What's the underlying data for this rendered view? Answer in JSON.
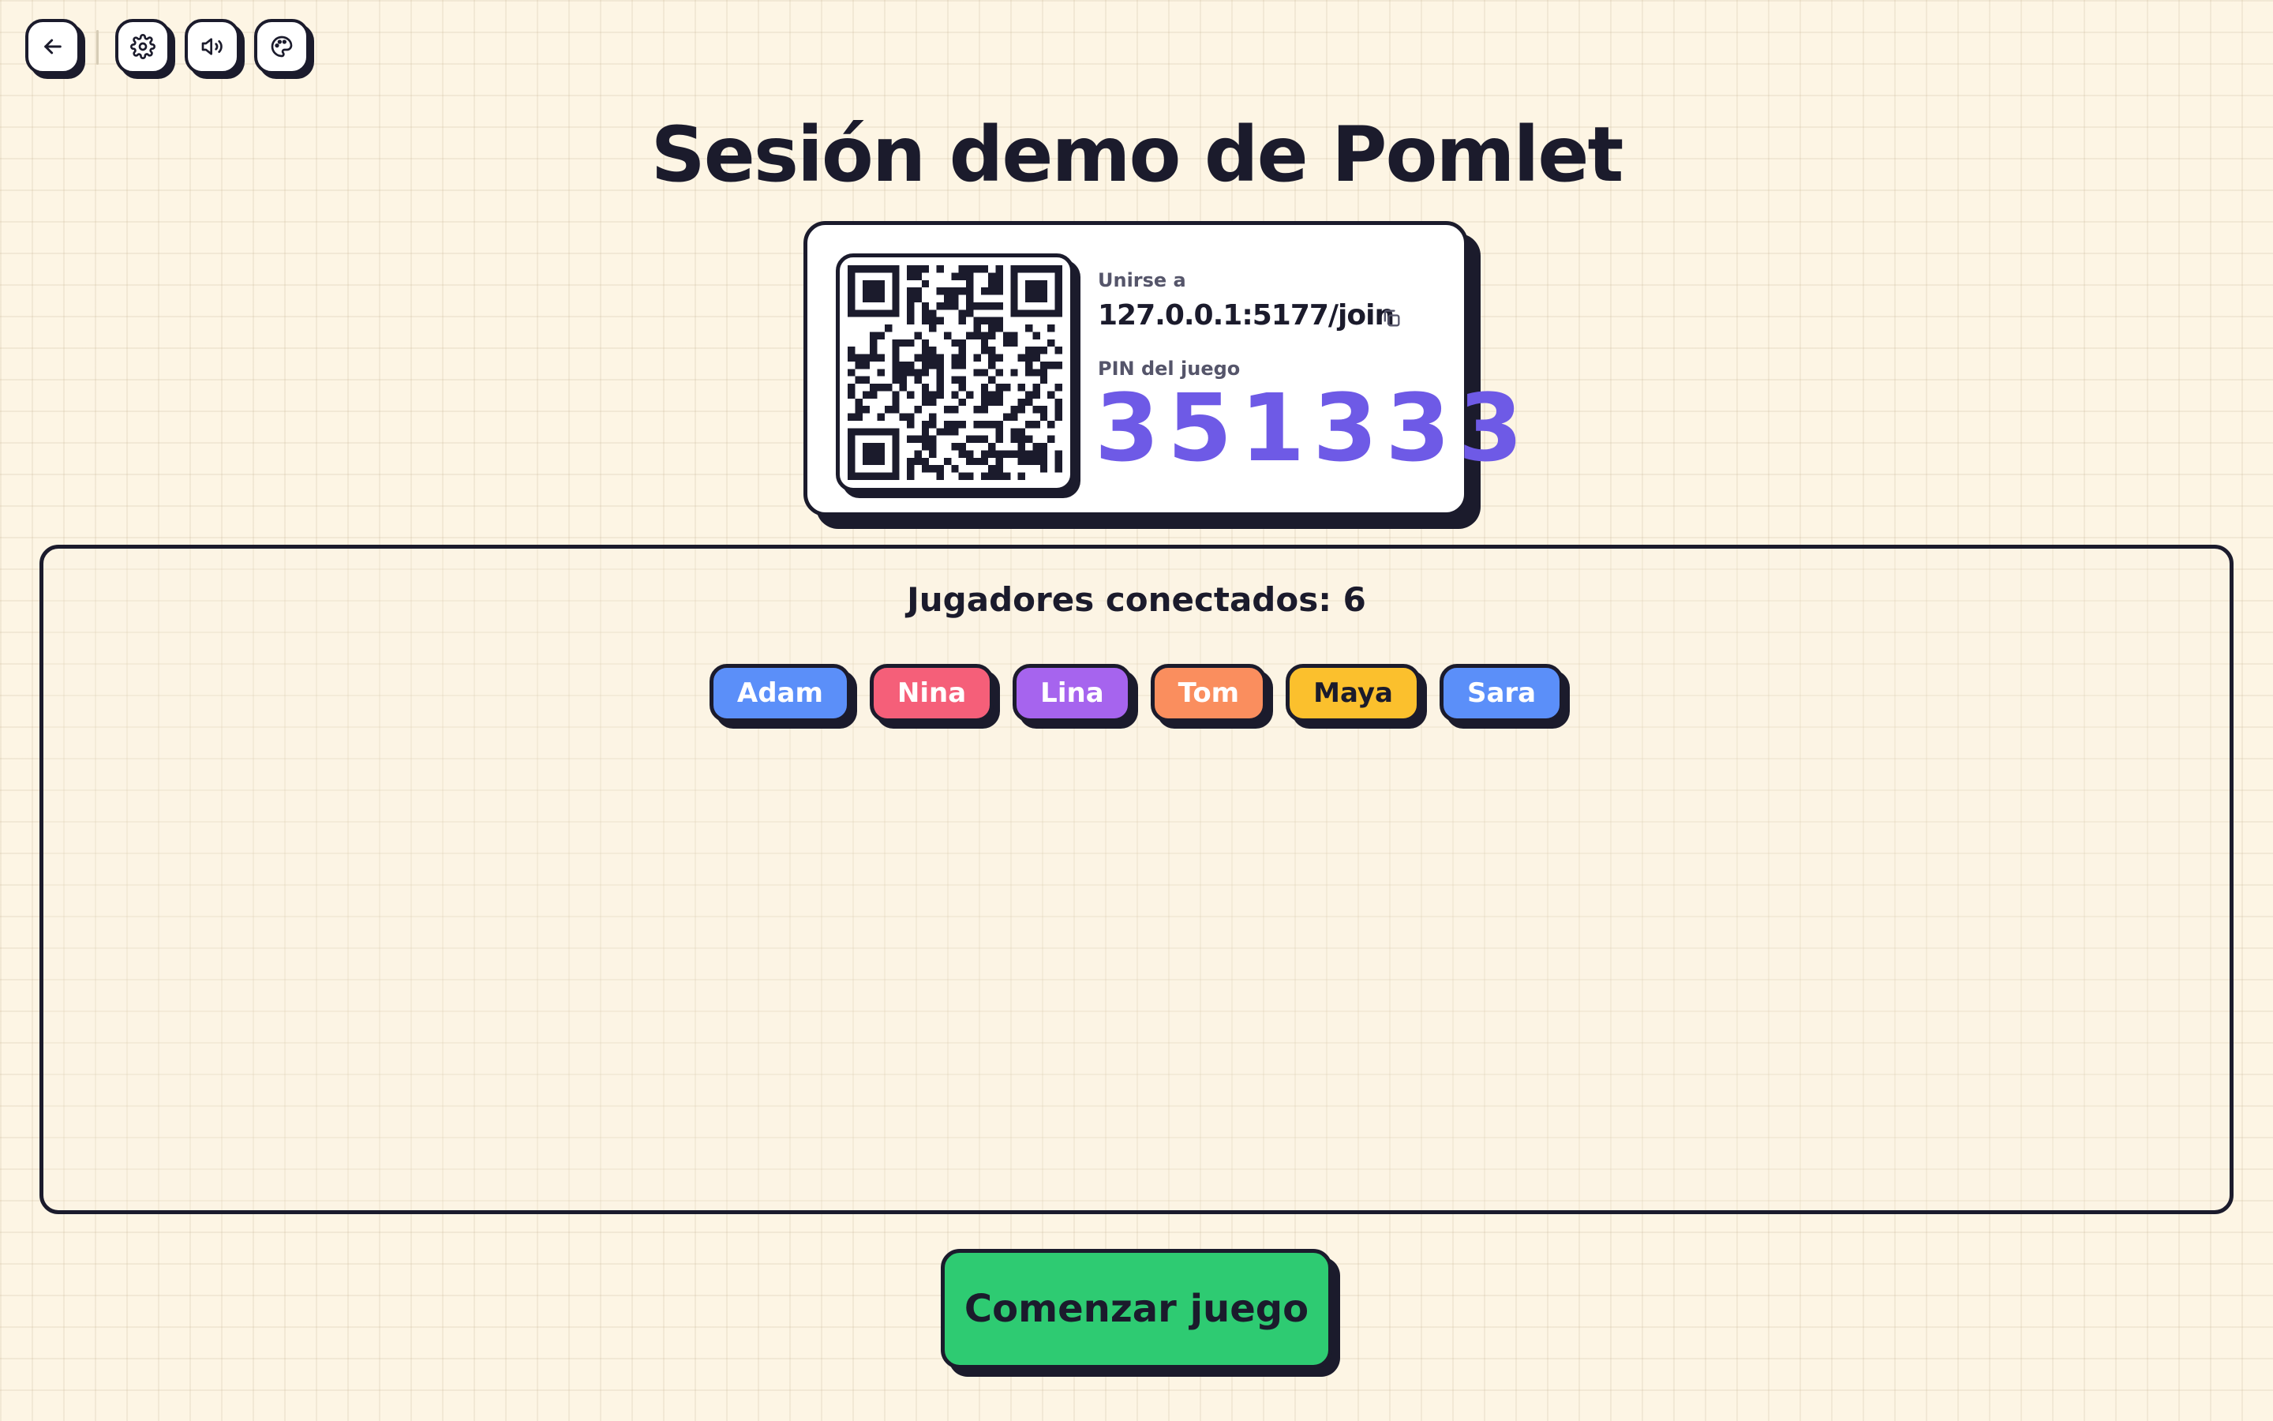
{
  "toolbar": {
    "buttons": [
      {
        "icon": "arrow-left-icon",
        "label": "back"
      },
      {
        "icon": "gear-icon",
        "label": "settings"
      },
      {
        "icon": "volume-icon",
        "label": "sound"
      },
      {
        "icon": "palette-icon",
        "label": "theme"
      }
    ]
  },
  "title": "Sesión demo de Pomlet",
  "join": {
    "label": "Unirse a",
    "url": "127.0.0.1:5177/join",
    "copy_icon": "copy-icon",
    "pin_label": "PIN del juego",
    "pin": "351333",
    "pin_color": "#6e5ae6"
  },
  "players": {
    "title": "Jugadores conectados: 6",
    "list": [
      {
        "name": "Adam",
        "color": "#5b8ff9",
        "text_color": "#ffffff"
      },
      {
        "name": "Nina",
        "color": "#f55f79",
        "text_color": "#ffffff"
      },
      {
        "name": "Lina",
        "color": "#a664ee",
        "text_color": "#ffffff"
      },
      {
        "name": "Tom",
        "color": "#fa8e5e",
        "text_color": "#ffffff"
      },
      {
        "name": "Maya",
        "color": "#fbc02d",
        "text_color": "#1b1b2c"
      },
      {
        "name": "Sara",
        "color": "#5b8ff9",
        "text_color": "#ffffff"
      }
    ]
  },
  "start_button": {
    "label": "Comenzar juego",
    "color": "#2ecb72"
  }
}
